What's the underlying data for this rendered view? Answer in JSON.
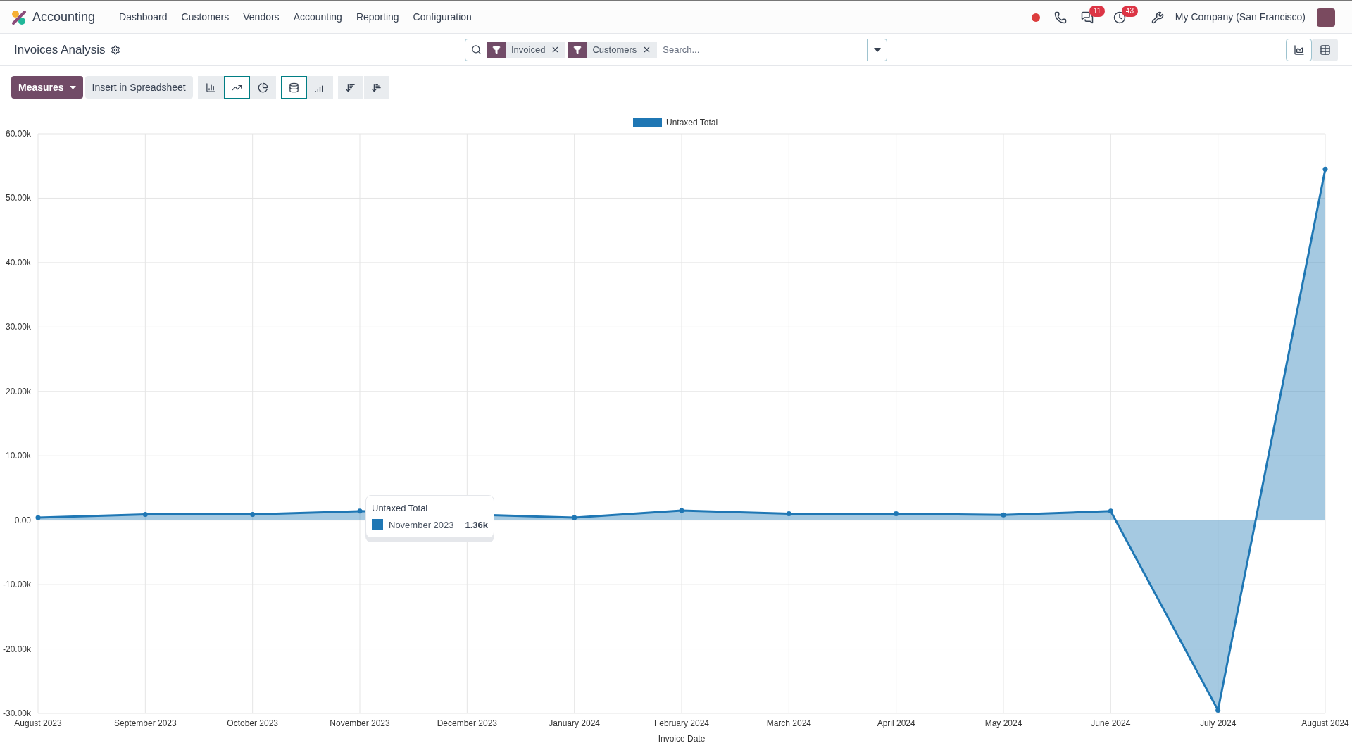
{
  "navbar": {
    "app_name": "Accounting",
    "menu": [
      "Dashboard",
      "Customers",
      "Vendors",
      "Accounting",
      "Reporting",
      "Configuration"
    ],
    "message_count": "11",
    "activity_count": "43",
    "company": "My Company (San Francisco)"
  },
  "control_panel": {
    "title": "Invoices Analysis",
    "search": {
      "facets": [
        {
          "label": "Invoiced"
        },
        {
          "label": "Customers"
        }
      ],
      "placeholder": "Search..."
    },
    "views": [
      {
        "kind": "graph",
        "selected": true
      },
      {
        "kind": "pivot",
        "selected": false
      }
    ]
  },
  "toolbar": {
    "measures": "Measures",
    "insert": "Insert in Spreadsheet",
    "chart_types": [
      {
        "kind": "bar",
        "selected": false
      },
      {
        "kind": "line",
        "selected": true
      },
      {
        "kind": "pie",
        "selected": false
      }
    ],
    "options": [
      {
        "kind": "stacked",
        "on": true
      },
      {
        "kind": "cumulative",
        "on": false
      }
    ],
    "sorts": [
      {
        "kind": "descending"
      },
      {
        "kind": "ascending"
      }
    ]
  },
  "chart": {
    "chart_data": {
      "type": "area",
      "xlabel": "Invoice Date",
      "categories": [
        "August 2023",
        "September 2023",
        "October 2023",
        "November 2023",
        "December 2023",
        "January 2024",
        "February 2024",
        "March 2024",
        "April 2024",
        "May 2024",
        "June 2024",
        "July 2024",
        "August 2024"
      ],
      "series": [
        {
          "name": "Untaxed Total",
          "color": "#1f77b4",
          "values": [
            0.4,
            0.9,
            0.9,
            1.4,
            null,
            0.4,
            1.5,
            1.0,
            1.0,
            0.8,
            1.4,
            -29.5,
            54.5
          ]
        }
      ],
      "grid": true,
      "ylim": [
        -30,
        60
      ],
      "yticks": [
        {
          "value": -30,
          "label": "-30.00k"
        },
        {
          "value": -20,
          "label": "-20.00k"
        },
        {
          "value": -10,
          "label": "-10.00k"
        },
        {
          "value": 0,
          "label": "0.00"
        },
        {
          "value": 10,
          "label": "10.00k"
        },
        {
          "value": 20,
          "label": "20.00k"
        },
        {
          "value": 30,
          "label": "30.00k"
        },
        {
          "value": 40,
          "label": "40.00k"
        },
        {
          "value": 50,
          "label": "50.00k"
        },
        {
          "value": 60,
          "label": "60.00k"
        }
      ]
    },
    "tooltip": {
      "title": "Untaxed Total",
      "label": "November 2023",
      "value": "1.36k"
    }
  }
}
